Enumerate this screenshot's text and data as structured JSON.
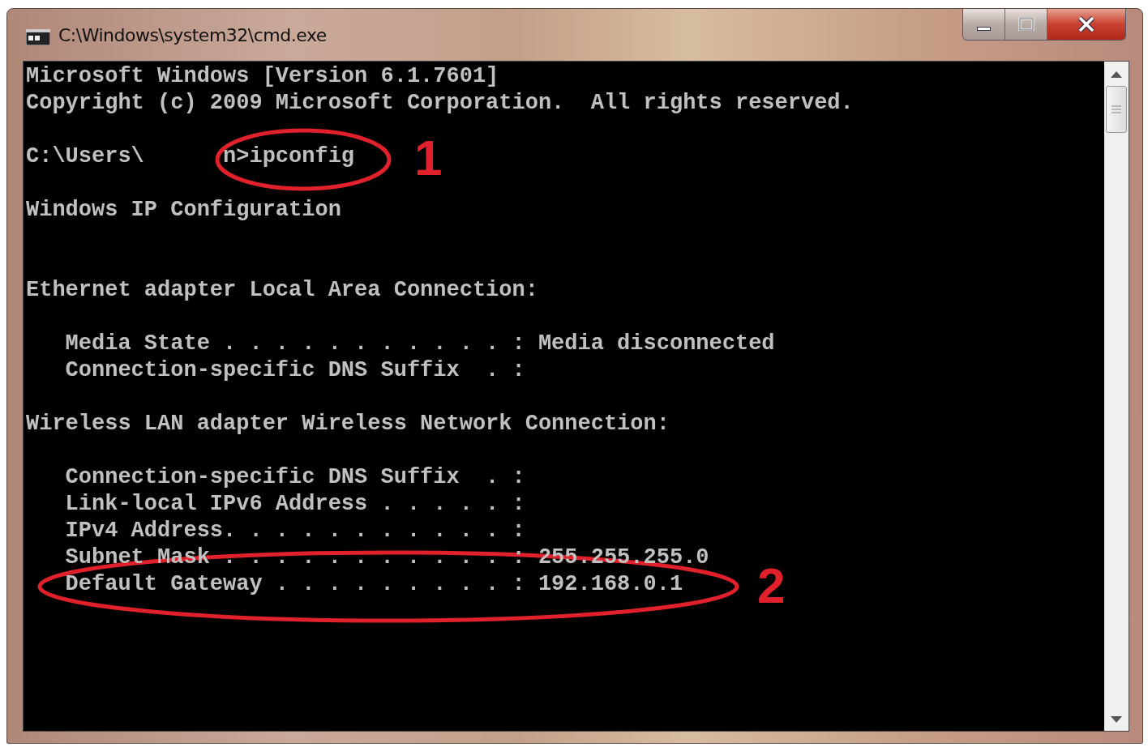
{
  "window": {
    "title": "C:\\Windows\\system32\\cmd.exe"
  },
  "console": {
    "lines": [
      {
        "kind": "text",
        "text": "Microsoft Windows [Version 6.1.7601]"
      },
      {
        "kind": "text",
        "text": "Copyright (c) 2009 Microsoft Corporation.  All rights reserved."
      },
      {
        "kind": "blank"
      },
      {
        "kind": "prompt",
        "path": "C:\\Users\\",
        "command": "n>ipconfig"
      },
      {
        "kind": "blank"
      },
      {
        "kind": "text",
        "text": "Windows IP Configuration"
      },
      {
        "kind": "blank"
      },
      {
        "kind": "blank"
      },
      {
        "kind": "text",
        "text": "Ethernet adapter Local Area Connection:"
      },
      {
        "kind": "blank"
      },
      {
        "kind": "text",
        "text": "   Media State . . . . . . . . . . . : Media disconnected"
      },
      {
        "kind": "text",
        "text": "   Connection-specific DNS Suffix  . :"
      },
      {
        "kind": "blank"
      },
      {
        "kind": "text",
        "text": "Wireless LAN adapter Wireless Network Connection:"
      },
      {
        "kind": "blank"
      },
      {
        "kind": "text",
        "text": "   Connection-specific DNS Suffix  . :"
      },
      {
        "kind": "text",
        "text": "   Link-local IPv6 Address . . . . . :"
      },
      {
        "kind": "text",
        "text": "   IPv4 Address. . . . . . . . . . . :"
      },
      {
        "kind": "text",
        "text": "   Subnet Mask . . . . . . . . . . . : 255.255.255.0"
      },
      {
        "kind": "text",
        "text": "   Default Gateway . . . . . . . . . : 192.168.0.1"
      }
    ]
  },
  "annotations": [
    {
      "label": "1"
    },
    {
      "label": "2"
    }
  ]
}
